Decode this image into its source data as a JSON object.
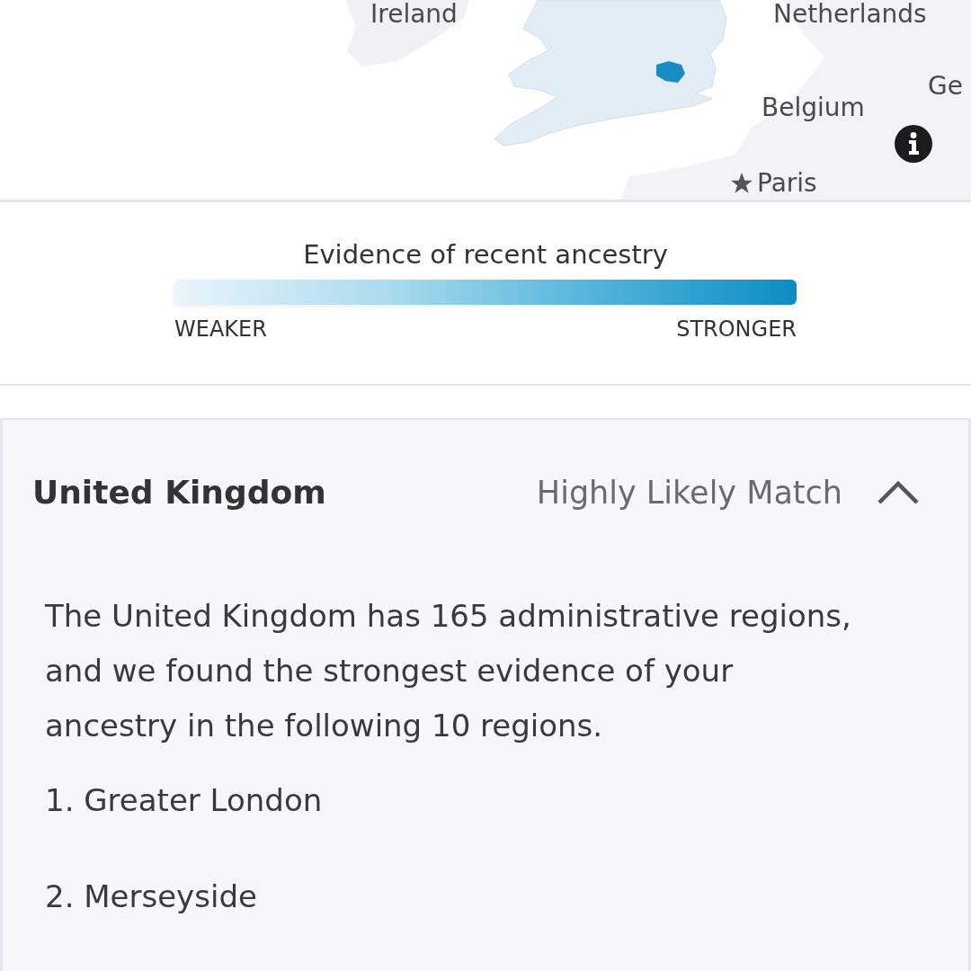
{
  "map": {
    "labels": [
      {
        "text": "Ireland",
        "kind": "country"
      },
      {
        "text": "Netherlands",
        "kind": "country"
      },
      {
        "text": "Belgium",
        "kind": "country"
      },
      {
        "text": "Ge",
        "kind": "country"
      },
      {
        "text": "Paris",
        "kind": "capital"
      }
    ]
  },
  "legend": {
    "title": "Evidence of recent ancestry",
    "min_label": "WEAKER",
    "max_label": "STRONGER"
  },
  "accordion": {
    "title": "United Kingdom",
    "match": "Highly Likely Match",
    "expanded": true,
    "description_lines": [
      "The United Kingdom has 165 administrative regions,",
      "and we found the strongest evidence of your",
      "ancestry in the following 10 regions."
    ],
    "regions": [
      "1. Greater London",
      "2. Merseyside"
    ]
  }
}
